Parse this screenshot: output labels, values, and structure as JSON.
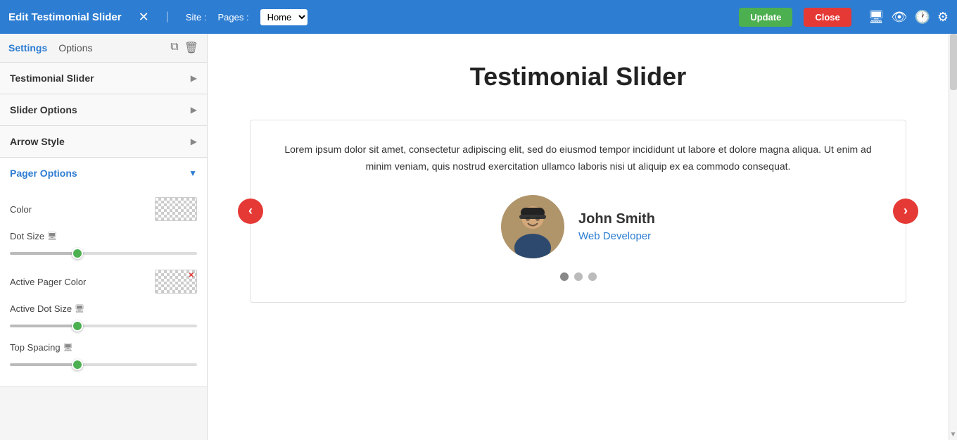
{
  "header": {
    "title": "Edit Testimonial Slider",
    "close_label": "✕",
    "site_label": "Site :",
    "pages_label": "Pages :",
    "pages_selected": "Home",
    "update_label": "Update",
    "close_btn_label": "Close"
  },
  "sidebar": {
    "tab_settings": "Settings",
    "tab_options": "Options",
    "accordion": [
      {
        "id": "testimonial-slider",
        "label": "Testimonial Slider",
        "expanded": false
      },
      {
        "id": "slider-options",
        "label": "Slider Options",
        "expanded": false
      },
      {
        "id": "arrow-style",
        "label": "Arrow Style",
        "expanded": false
      },
      {
        "id": "pager-options",
        "label": "Pager Options",
        "expanded": true
      }
    ],
    "pager": {
      "color_label": "Color",
      "dot_size_label": "Dot Size",
      "active_pager_color_label": "Active Pager Color",
      "active_dot_size_label": "Active Dot Size",
      "top_spacing_label": "Top Spacing"
    }
  },
  "content": {
    "page_title": "Testimonial Slider",
    "testimonial_text": "Lorem ipsum dolor sit amet, consectetur adipiscing elit, sed do eiusmod tempor incididunt ut labore et dolore magna aliqua. Ut enim ad minim veniam, quis nostrud exercitation ullamco laboris nisi ut aliquip ex ea commodo consequat.",
    "author_name": "John Smith",
    "author_role": "Web Developer",
    "dots": [
      {
        "active": true
      },
      {
        "active": false
      },
      {
        "active": false
      }
    ]
  }
}
